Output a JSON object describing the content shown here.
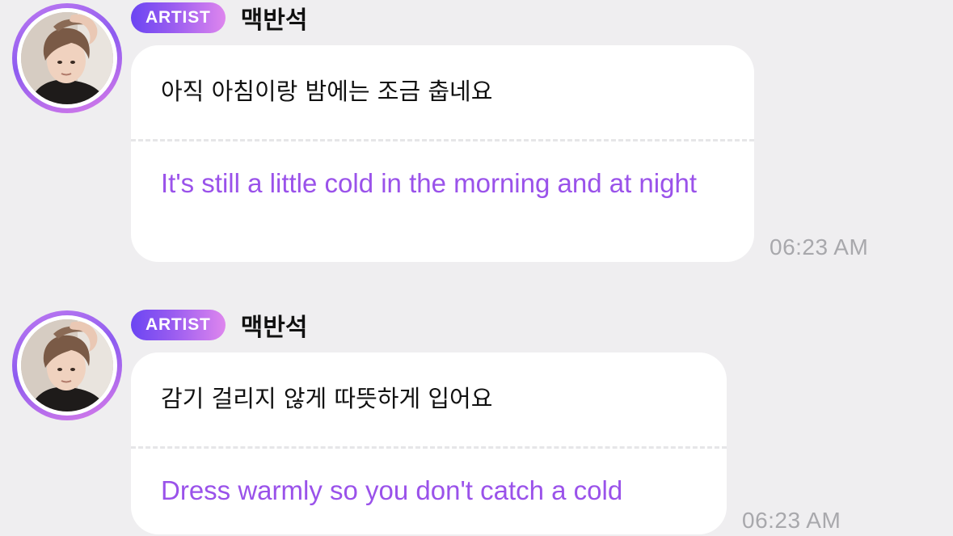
{
  "colors": {
    "background": "#efeef0",
    "bubble": "#ffffff",
    "translation_text": "#9a52ea",
    "timestamp_text": "#a8a8ac",
    "badge_gradient_start": "#6b45f2",
    "badge_gradient_end": "#de86ee",
    "avatar_ring": "#a36af0"
  },
  "messages": [
    {
      "avatar_icon": "artist-profile-photo",
      "badge": "ARTIST",
      "sender": "맥반석",
      "original_text": "아직 아침이랑 밤에는 조금 춥네요",
      "translation": "It's still a little cold in the morning and at night",
      "time": "06:23 AM"
    },
    {
      "avatar_icon": "artist-profile-photo",
      "badge": "ARTIST",
      "sender": "맥반석",
      "original_text": "감기 걸리지 않게 따뜻하게 입어요",
      "translation": "Dress warmly so you don't catch a cold",
      "time": "06:23 AM"
    }
  ]
}
